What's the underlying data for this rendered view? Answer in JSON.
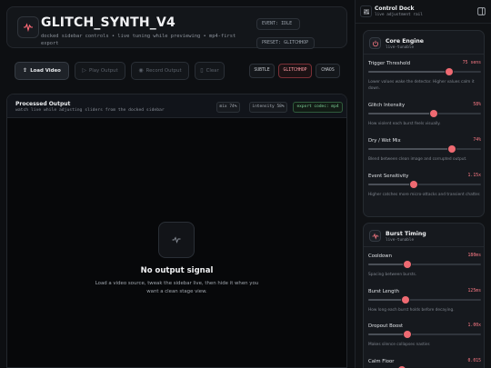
{
  "app": {
    "title": "GLITCH_SYNTH_V4",
    "subtitle": "docked sidebar controls • live tuning while previewing • mp4-first export",
    "event_chip": "EVENT: IDLE",
    "preset_chip": "PRESET: GLITCHHOP"
  },
  "toolbar": {
    "load_label": "Load Video",
    "play_label": "Play Output",
    "record_label": "Record Output",
    "clear_label": "Clear",
    "presets": [
      "SUBTLE",
      "GLITCHHOP",
      "CHAOS"
    ],
    "active_preset": "GLITCHHOP"
  },
  "output": {
    "title": "Processed Output",
    "subtitle": "watch live while adjusting sliders from the docked sidebar",
    "chips": {
      "mix": "mix 74%",
      "intensity": "intensity 58%",
      "export": "export codec: mp4"
    },
    "empty_title": "No output signal",
    "empty_message": "Load a video source, tweak the sidebar live, then hide it when you want a clean stage view."
  },
  "dock": {
    "title": "Control Dock",
    "subtitle": "live adjustment rail",
    "sections": [
      {
        "title": "Core Engine",
        "subtitle": "live-tunable",
        "icon": "power-icon",
        "params": [
          {
            "label": "Trigger Threshold",
            "value": "75 sens",
            "level": 0.72,
            "help": "Lower values wake the detector. Higher values calm it down."
          },
          {
            "label": "Glitch Intensity",
            "value": "58%",
            "level": 0.58,
            "help": "How violent each burst feels visually."
          },
          {
            "label": "Dry / Wet Mix",
            "value": "74%",
            "level": 0.74,
            "help": "Blend between clean image and corrupted output."
          },
          {
            "label": "Event Sensitivity",
            "value": "1.15x",
            "level": 0.4,
            "help": "Higher catches more micro-attacks and transient chatter."
          }
        ]
      },
      {
        "title": "Burst Timing",
        "subtitle": "live-tunable",
        "icon": "pulse-icon",
        "params": [
          {
            "label": "Cooldown",
            "value": "180ms",
            "level": 0.35,
            "help": "Spacing between bursts."
          },
          {
            "label": "Burst Length",
            "value": "125ms",
            "level": 0.33,
            "help": "How long each burst holds before decaying."
          },
          {
            "label": "Dropout Boost",
            "value": "1.00x",
            "level": 0.35,
            "help": "Makes silence collapses nastier."
          },
          {
            "label": "Calm Floor",
            "value": "0.015",
            "level": 0.3,
            "help": ""
          }
        ]
      }
    ]
  },
  "colors": {
    "accent": "#ef6a72",
    "background": "#0d0f12",
    "success": "#7fd39a"
  }
}
